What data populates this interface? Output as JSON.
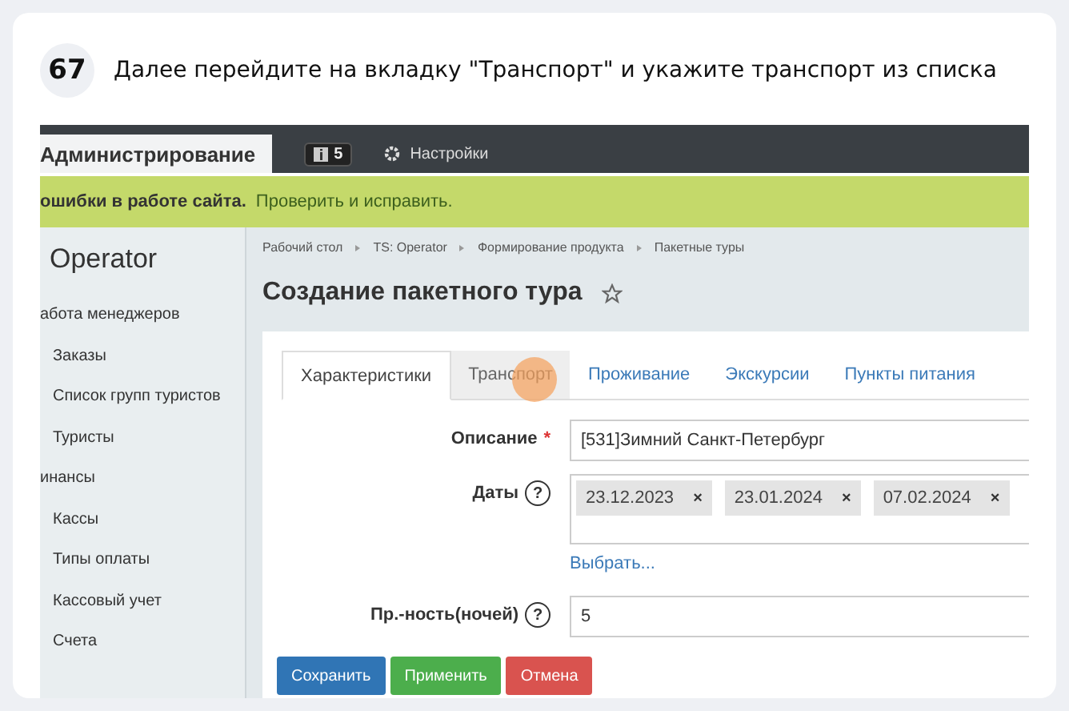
{
  "step": {
    "number": "67",
    "text": "Далее перейдите на вкладку \"Транспорт\" и укажите транспорт из списка"
  },
  "topbar": {
    "tab": "Администрирование",
    "badge": "5",
    "settings": "Настройки"
  },
  "notice": {
    "text": "ошибки в работе сайта.",
    "link": "Проверить и исправить."
  },
  "sidebar": {
    "title": "Operator",
    "items": [
      {
        "kind": "section",
        "label": "абота менеджеров"
      },
      {
        "kind": "item",
        "label": "Заказы"
      },
      {
        "kind": "item",
        "label": "Список групп туристов"
      },
      {
        "kind": "item",
        "label": "Туристы"
      },
      {
        "kind": "section",
        "label": "инансы"
      },
      {
        "kind": "item",
        "label": "Кассы"
      },
      {
        "kind": "item",
        "label": "Типы оплаты"
      },
      {
        "kind": "item",
        "label": "Кассовый учет"
      },
      {
        "kind": "item",
        "label": "Счета"
      }
    ]
  },
  "breadcrumbs": [
    "Рабочий стол",
    "TS: Operator",
    "Формирование продукта",
    "Пакетные туры"
  ],
  "page_title": "Создание пакетного тура",
  "tabs": [
    {
      "label": "Характеристики",
      "selected": true,
      "highlighted": false
    },
    {
      "label": "Транспорт",
      "selected": false,
      "highlighted": true
    },
    {
      "label": "Проживание",
      "selected": false,
      "highlighted": false
    },
    {
      "label": "Экскурсии",
      "selected": false,
      "highlighted": false
    },
    {
      "label": "Пункты питания",
      "selected": false,
      "highlighted": false
    }
  ],
  "form": {
    "description": {
      "label": "Описание",
      "required": true,
      "required_mark": "*",
      "value": "[531]Зимний Санкт-Петербург"
    },
    "dates": {
      "label": "Даты",
      "help": "?",
      "tags": [
        "23.12.2023",
        "23.01.2024",
        "07.02.2024"
      ],
      "remove": "×",
      "link": "Выбрать..."
    },
    "nights": {
      "label": "Пр.-ность(ночей)",
      "help": "?",
      "value": "5"
    }
  },
  "buttons": [
    {
      "kind": "primary",
      "label": "Сохранить"
    },
    {
      "kind": "success",
      "label": "Применить"
    },
    {
      "kind": "danger",
      "label": "Отмена"
    }
  ]
}
